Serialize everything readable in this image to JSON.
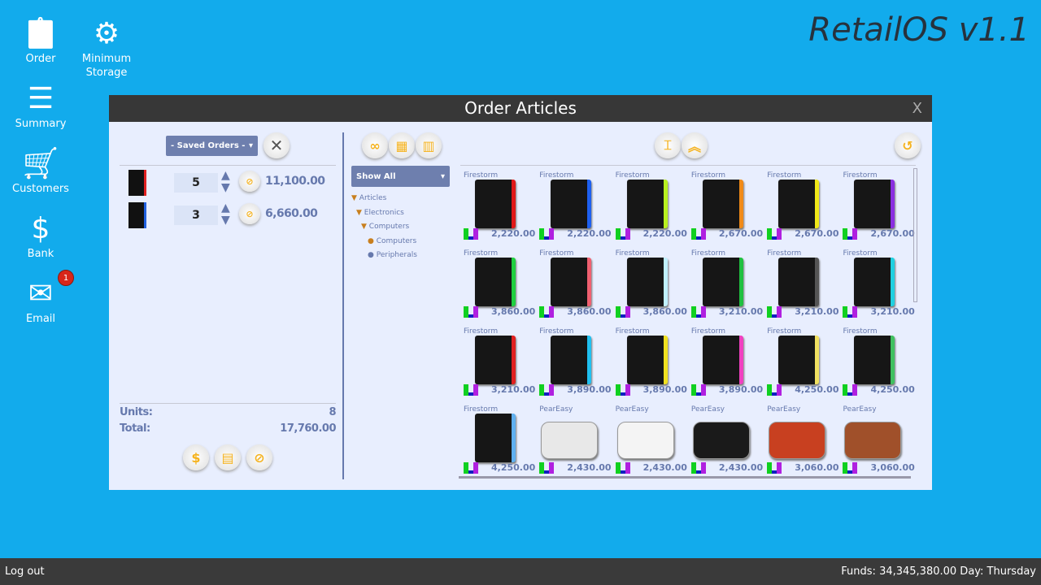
{
  "desktop": {
    "brand": "RetailOS v1.1",
    "icons": [
      {
        "label": "Order",
        "icon": "clipboard-icon"
      },
      {
        "label": "Minimum\nStorage",
        "icon": "storage-icon"
      },
      {
        "label": "Summary",
        "icon": "list-icon"
      },
      {
        "label": "Customers",
        "icon": "cart-icon"
      },
      {
        "label": "Bank",
        "icon": "coins-icon"
      },
      {
        "label": "Email",
        "icon": "envelope-icon",
        "badge": "1"
      }
    ]
  },
  "taskbar": {
    "logout": "Log out",
    "status": "Funds: 34,345,380.00  Day: Thursday"
  },
  "window": {
    "title": "Order Articles",
    "close": "X"
  },
  "order": {
    "saved_orders": "- Saved Orders -",
    "lines": [
      {
        "qty": "5",
        "amount": "11,100.00",
        "accent": "#e02020"
      },
      {
        "qty": "3",
        "amount": "6,660.00",
        "accent": "#2060e0"
      }
    ],
    "units_label": "Units:",
    "units": "8",
    "total_label": "Total:",
    "total": "17,760.00"
  },
  "filter": {
    "show": "Show All",
    "tree": [
      "Articles",
      "Electronics",
      "Computers",
      "Computers",
      "Peripherals"
    ]
  },
  "products": [
    {
      "brand": "Firestorm",
      "price": "2,220.00",
      "accent": "#e01818"
    },
    {
      "brand": "Firestorm",
      "price": "2,220.00",
      "accent": "#1e60f0"
    },
    {
      "brand": "Firestorm",
      "price": "2,220.00",
      "accent": "#b8f020"
    },
    {
      "brand": "Firestorm",
      "price": "2,670.00",
      "accent": "#f08a18"
    },
    {
      "brand": "Firestorm",
      "price": "2,670.00",
      "accent": "#f0e818"
    },
    {
      "brand": "Firestorm",
      "price": "2,670.00",
      "accent": "#8a2ee0"
    },
    {
      "brand": "Firestorm",
      "price": "3,860.00",
      "accent": "#20d040"
    },
    {
      "brand": "Firestorm",
      "price": "3,860.00",
      "accent": "#f06070"
    },
    {
      "brand": "Firestorm",
      "price": "3,860.00",
      "accent": "#c0f0ff"
    },
    {
      "brand": "Firestorm",
      "price": "3,210.00",
      "accent": "#20c040"
    },
    {
      "brand": "Firestorm",
      "price": "3,210.00",
      "accent": "#555555"
    },
    {
      "brand": "Firestorm",
      "price": "3,210.00",
      "accent": "#20d0e0"
    },
    {
      "brand": "Firestorm",
      "price": "3,210.00",
      "accent": "#e02020"
    },
    {
      "brand": "Firestorm",
      "price": "3,890.00",
      "accent": "#20c0f0"
    },
    {
      "brand": "Firestorm",
      "price": "3,890.00",
      "accent": "#f0e020"
    },
    {
      "brand": "Firestorm",
      "price": "3,890.00",
      "accent": "#f040c0"
    },
    {
      "brand": "Firestorm",
      "price": "4,250.00",
      "accent": "#f0e060"
    },
    {
      "brand": "Firestorm",
      "price": "4,250.00",
      "accent": "#40c060"
    },
    {
      "brand": "Firestorm",
      "price": "4,250.00",
      "accent": "#60b0f0"
    },
    {
      "brand": "PearEasy",
      "price": "2,430.00",
      "accent": "#e8e8e8"
    },
    {
      "brand": "PearEasy",
      "price": "2,430.00",
      "accent": "#f4f4f4"
    },
    {
      "brand": "PearEasy",
      "price": "2,430.00",
      "accent": "#1a1a1a"
    },
    {
      "brand": "PearEasy",
      "price": "3,060.00",
      "accent": "#c84020"
    },
    {
      "brand": "PearEasy",
      "price": "3,060.00",
      "accent": "#a0502a"
    }
  ]
}
